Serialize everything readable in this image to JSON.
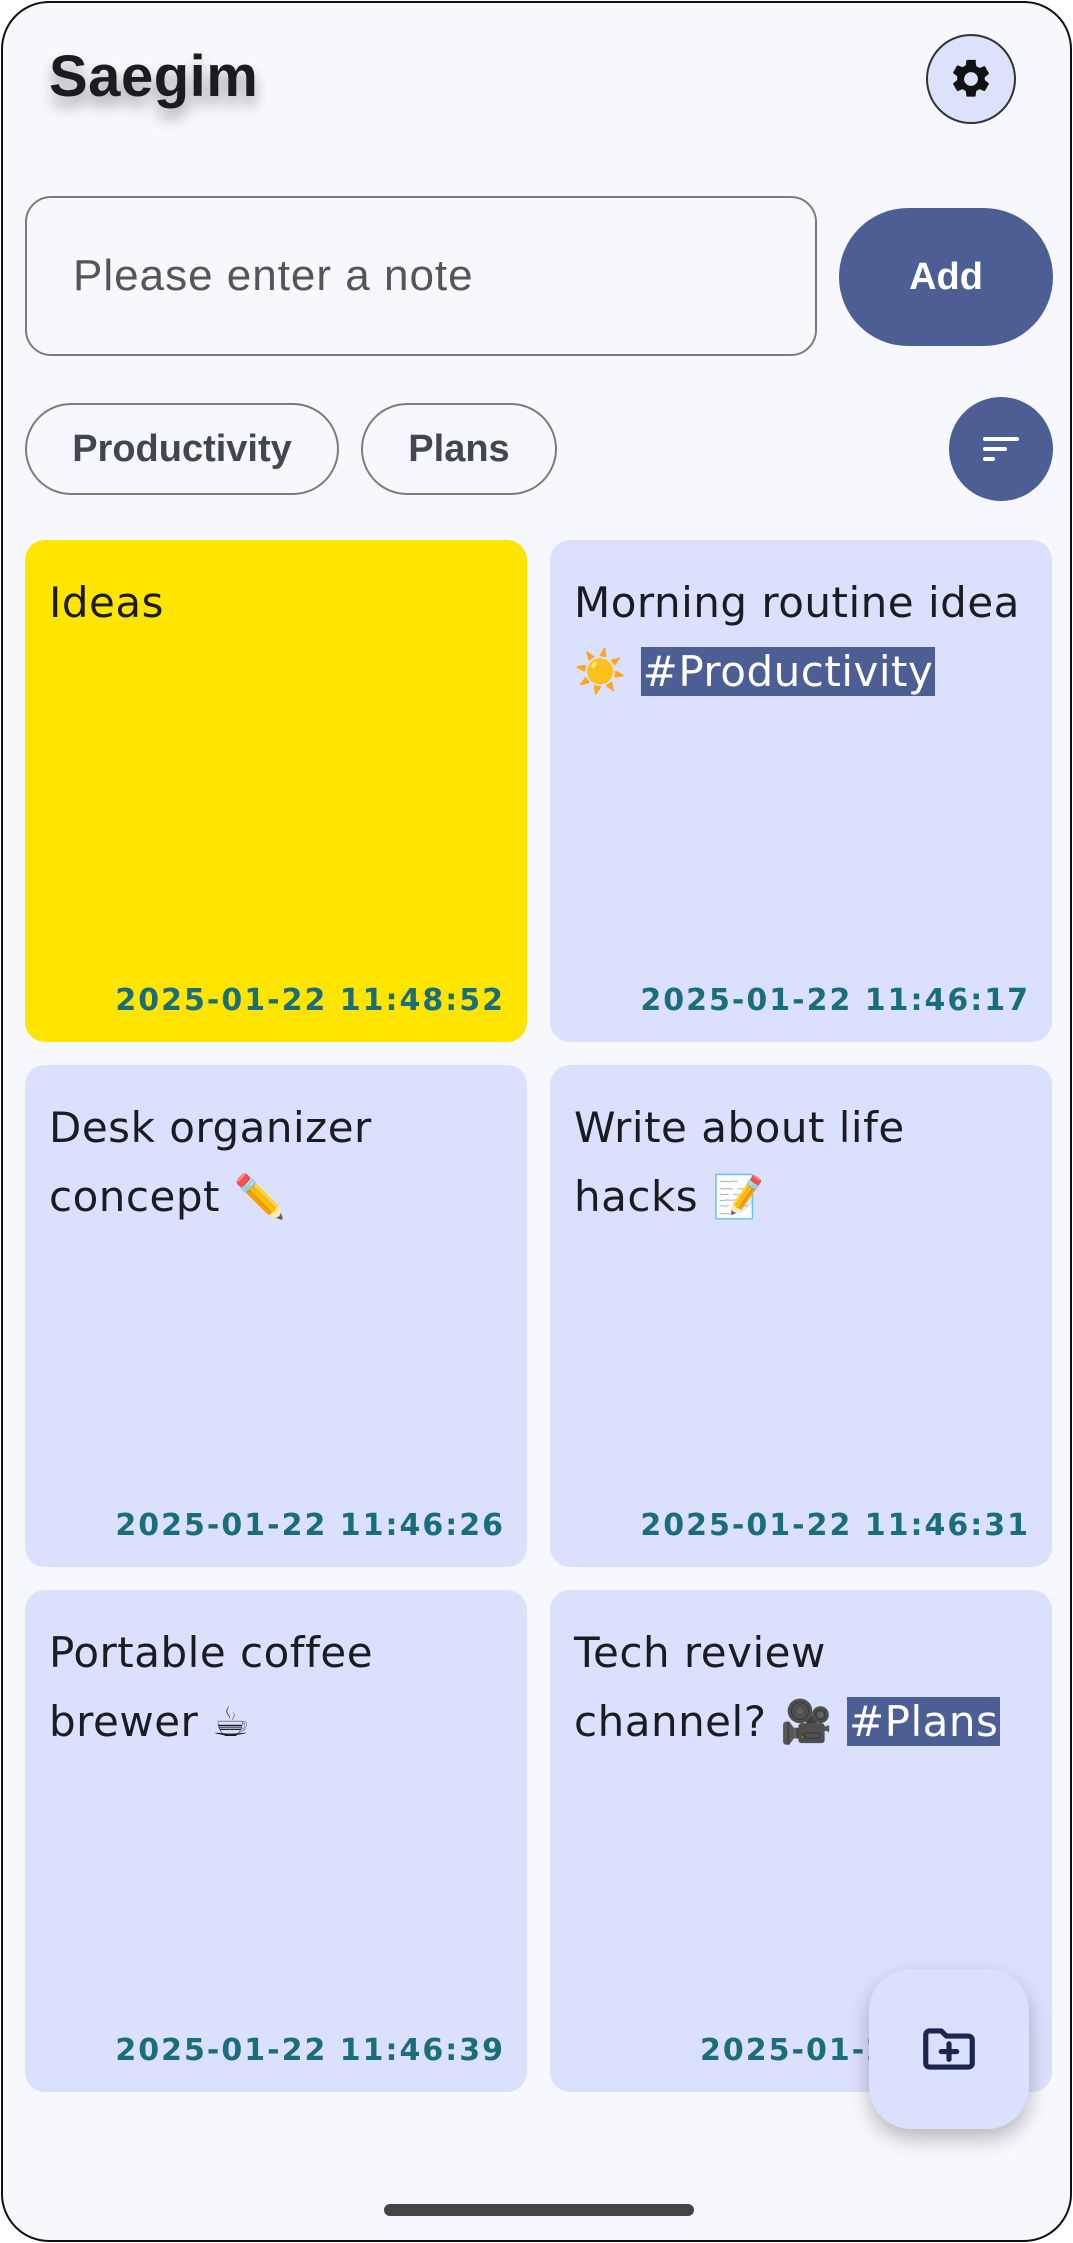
{
  "app": {
    "title": "Saegim"
  },
  "input": {
    "placeholder": "Please enter a note",
    "value": ""
  },
  "add_button": {
    "label": "Add"
  },
  "tags": [
    {
      "label": "Productivity"
    },
    {
      "label": "Plans"
    }
  ],
  "notes": [
    {
      "text": "Ideas",
      "tag": "",
      "date": "2025-01-22 11:48:52",
      "color": "#ffe500"
    },
    {
      "text": "Morning routine idea ☀️ ",
      "tag": "#Productivity",
      "date": "2025-01-22 11:46:17",
      "color": "#dbe0fc"
    },
    {
      "text": "Desk organizer concept ✏️",
      "tag": "",
      "date": "2025-01-22 11:46:26",
      "color": "#dbe0fc"
    },
    {
      "text": "Write about life hacks 📝",
      "tag": "",
      "date": "2025-01-22 11:46:31",
      "color": "#dbe0fc"
    },
    {
      "text": "Portable coffee brewer ☕",
      "tag": "",
      "date": "2025-01-22 11:46:39",
      "color": "#dbe0fc"
    },
    {
      "text": "Tech review channel? 🎥 ",
      "tag": "#Plans",
      "date": "2025-01-22",
      "color": "#dbe0fc"
    }
  ],
  "icons": {
    "settings": "gear-icon",
    "sort": "sort-icon",
    "fab": "folder-add-icon"
  },
  "colors": {
    "accent": "#4d5e94",
    "card": "#dbe0fc",
    "highlight_card": "#ffe500",
    "date_text": "#1a6d7a",
    "background": "#f7f8fd"
  }
}
